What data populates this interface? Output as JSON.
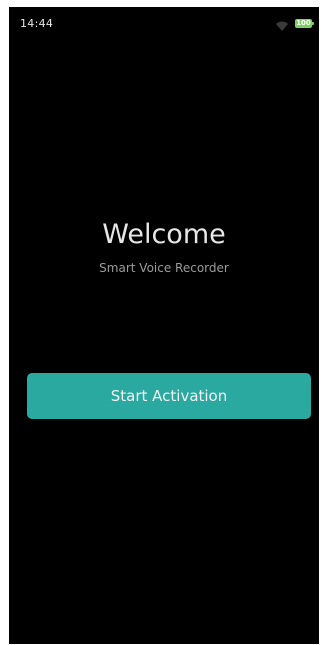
{
  "status_bar": {
    "time": "14:44",
    "wifi_icon": "wifi-icon",
    "battery_icon": "battery-icon",
    "battery_level": "100"
  },
  "welcome": {
    "title": "Welcome",
    "subtitle": "Smart Voice Recorder"
  },
  "actions": {
    "start_activation_label": "Start Activation"
  },
  "colors": {
    "background": "#000000",
    "accent": "#2aa9a1",
    "battery": "#7ad15f"
  }
}
